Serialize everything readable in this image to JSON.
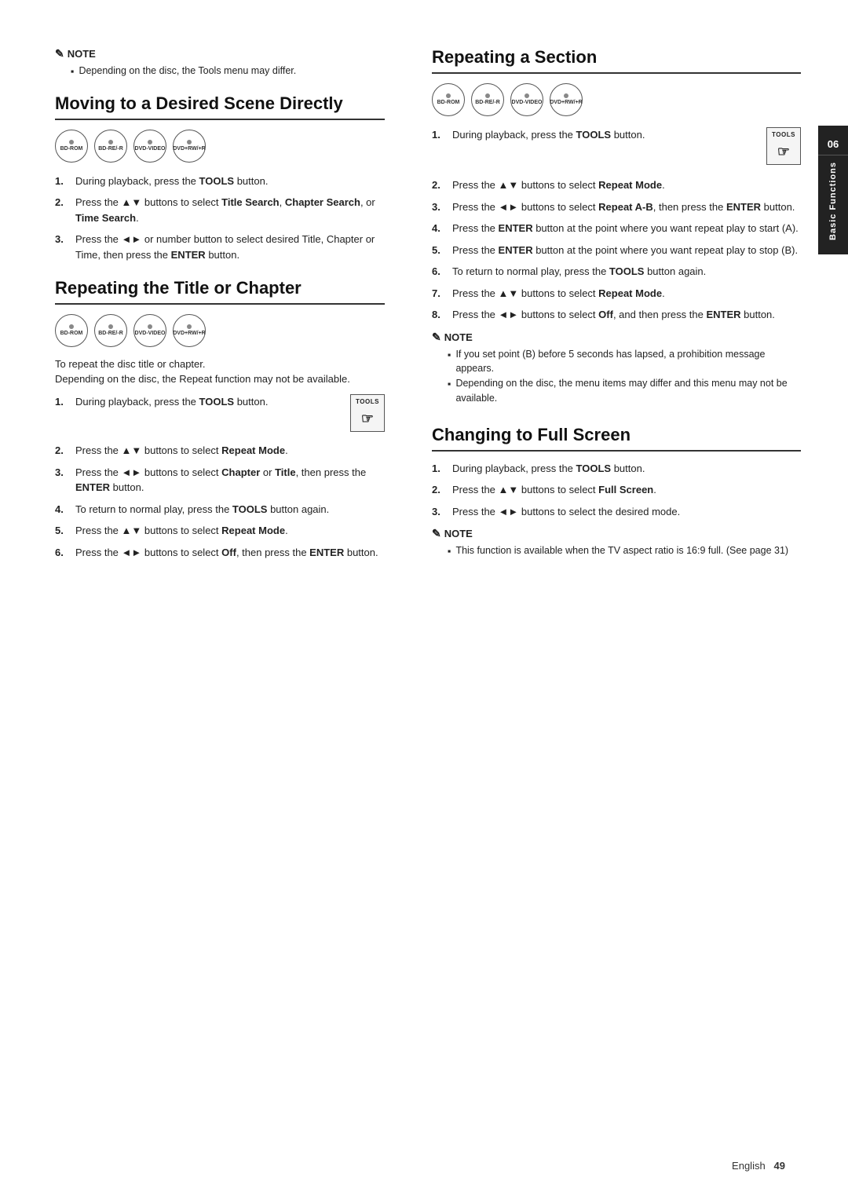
{
  "page": {
    "number": "49",
    "language": "English",
    "chapter_num": "06",
    "chapter_label": "Basic Functions"
  },
  "note_section": {
    "label": "NOTE",
    "items": [
      "Depending on the disc, the Tools menu may differ."
    ]
  },
  "section_moving": {
    "title": "Moving to a Desired Scene Directly",
    "steps": [
      {
        "text_before": "During playback, press the ",
        "bold": "TOOLS",
        "text_after": " button."
      },
      {
        "text_before": "Press the ▲▼ buttons to select ",
        "bold": "Title Search",
        "text_mid": ", ",
        "bold2": "Chapter Search",
        "text_after": ", or ",
        "bold3": "Time Search",
        "text_end": "."
      },
      {
        "text_before": "Press the ◄► or number button to select desired Title, Chapter or Time, then press the ",
        "bold": "ENTER",
        "text_after": " button."
      }
    ]
  },
  "section_repeat_title": {
    "title": "Repeating the Title or Chapter",
    "intro": [
      "To repeat the disc title or chapter.",
      "Depending on the disc, the Repeat function may not be available."
    ],
    "steps": [
      {
        "text_before": "During playback, press the ",
        "bold": "TOOLS",
        "text_after": " button.",
        "has_tools_icon": true
      },
      {
        "text_before": "Press the ▲▼ buttons to select ",
        "bold": "Repeat Mode",
        "text_after": "."
      },
      {
        "text_before": "Press the ◄► buttons to select ",
        "bold": "Chapter",
        "text_mid": " or ",
        "bold2": "Title",
        "text_after": ", then press the ",
        "bold3": "ENTER",
        "text_end": " button."
      },
      {
        "text_before": "To return to normal play, press the ",
        "bold": "TOOLS",
        "text_after": " button again."
      },
      {
        "text_before": "Press the ▲▼ buttons to select ",
        "bold": "Repeat Mode",
        "text_after": "."
      },
      {
        "text_before": "Press the ◄► buttons to select ",
        "bold": "Off",
        "text_after": ", then press the ",
        "bold2": "ENTER",
        "text_end": " button."
      }
    ]
  },
  "section_repeating": {
    "title": "Repeating a Section",
    "steps": [
      {
        "text_before": "During playback, press the ",
        "bold": "TOOLS",
        "text_after": " button.",
        "has_tools_icon": true
      },
      {
        "text_before": "Press the ▲▼ buttons to select ",
        "bold": "Repeat Mode",
        "text_after": "."
      },
      {
        "text_before": "Press the ◄► buttons to select ",
        "bold": "Repeat A-B",
        "text_after": ", then press the ",
        "bold2": "ENTER",
        "text_end": " button."
      },
      {
        "text_before": "Press the ",
        "bold": "ENTER",
        "text_after": " button at the point where you want repeat play to start (A)."
      },
      {
        "text_before": "Press the ",
        "bold": "ENTER",
        "text_after": " button at the point where you want repeat play to stop (B)."
      },
      {
        "text_before": "To return to normal play, press the ",
        "bold": "TOOLS",
        "text_after": " button again."
      },
      {
        "text_before": "Press the ▲▼ buttons to select ",
        "bold": "Repeat Mode",
        "text_after": "."
      },
      {
        "text_before": "Press the ◄► buttons to select ",
        "bold": "Off",
        "text_after": ", and then press the ",
        "bold2": "ENTER",
        "text_end": " button."
      }
    ],
    "note": {
      "label": "NOTE",
      "items": [
        "If you set point (B) before 5 seconds has lapsed, a prohibition message appears.",
        "Depending on the disc, the menu items may differ and this menu may not be available."
      ]
    }
  },
  "section_fullscreen": {
    "title": "Changing to Full Screen",
    "steps": [
      {
        "text_before": "During playback, press the ",
        "bold": "TOOLS",
        "text_after": " button."
      },
      {
        "text_before": "Press the ▲▼ buttons to select ",
        "bold": "Full Screen",
        "text_after": "."
      },
      {
        "text_before": "Press the ◄► buttons to select the desired mode."
      }
    ],
    "note": {
      "label": "NOTE",
      "items": [
        "This function is available when the TV aspect ratio is 16:9 full. (See page 31)"
      ]
    }
  },
  "disc_types": [
    "BD-ROM",
    "BD-RE/-R",
    "DVD-VIDEO",
    "DVD+RW/+R"
  ]
}
